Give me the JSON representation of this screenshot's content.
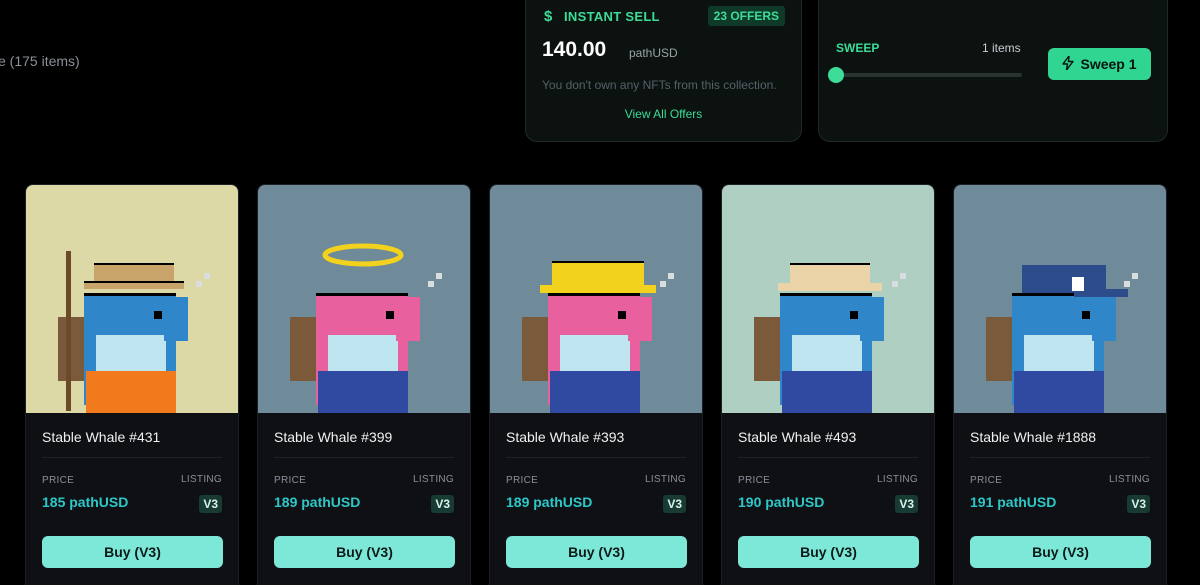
{
  "collection": {
    "items_count_text": "e (175 items)"
  },
  "instant_sell": {
    "title": "INSTANT SELL",
    "offers_badge": "23 OFFERS",
    "price": "140.00",
    "unit": "pathUSD",
    "note": "You don't own any NFTs from this collection.",
    "view_all_link": "View All Offers",
    "icon": "dollar-icon",
    "accent_color": "#3ddc97"
  },
  "sweep": {
    "title": "SWEEP",
    "count_text": "1 items",
    "slider_fraction": 0.04,
    "button_label": "Sweep 1",
    "button_icon": "lightning-icon"
  },
  "cards": [
    {
      "name": "Stable Whale #431",
      "price_label": "PRICE",
      "price": "185 pathUSD",
      "listing_label": "LISTING",
      "listing": "V3",
      "buy_label": "Buy (V3)",
      "bg_color": "#dcd9a6",
      "body_color": "#2f86c9",
      "hat": "straw",
      "halo": false
    },
    {
      "name": "Stable Whale #399",
      "price_label": "PRICE",
      "price": "189 pathUSD",
      "listing_label": "LISTING",
      "listing": "V3",
      "buy_label": "Buy (V3)",
      "bg_color": "#6f8a99",
      "body_color": "#e9609e",
      "hat": "none",
      "halo": true
    },
    {
      "name": "Stable Whale #393",
      "price_label": "PRICE",
      "price": "189 pathUSD",
      "listing_label": "LISTING",
      "listing": "V3",
      "buy_label": "Buy (V3)",
      "bg_color": "#6f8a99",
      "body_color": "#e9609e",
      "hat": "yellow",
      "halo": false
    },
    {
      "name": "Stable Whale #493",
      "price_label": "PRICE",
      "price": "190 pathUSD",
      "listing_label": "LISTING",
      "listing": "V3",
      "buy_label": "Buy (V3)",
      "bg_color": "#aecfc2",
      "body_color": "#2f86c9",
      "hat": "tan",
      "halo": false
    },
    {
      "name": "Stable Whale #1888",
      "price_label": "PRICE",
      "price": "191 pathUSD",
      "listing_label": "LISTING",
      "listing": "V3",
      "buy_label": "Buy (V3)",
      "bg_color": "#6f8a99",
      "body_color": "#2f86c9",
      "hat": "cap",
      "halo": false
    }
  ]
}
